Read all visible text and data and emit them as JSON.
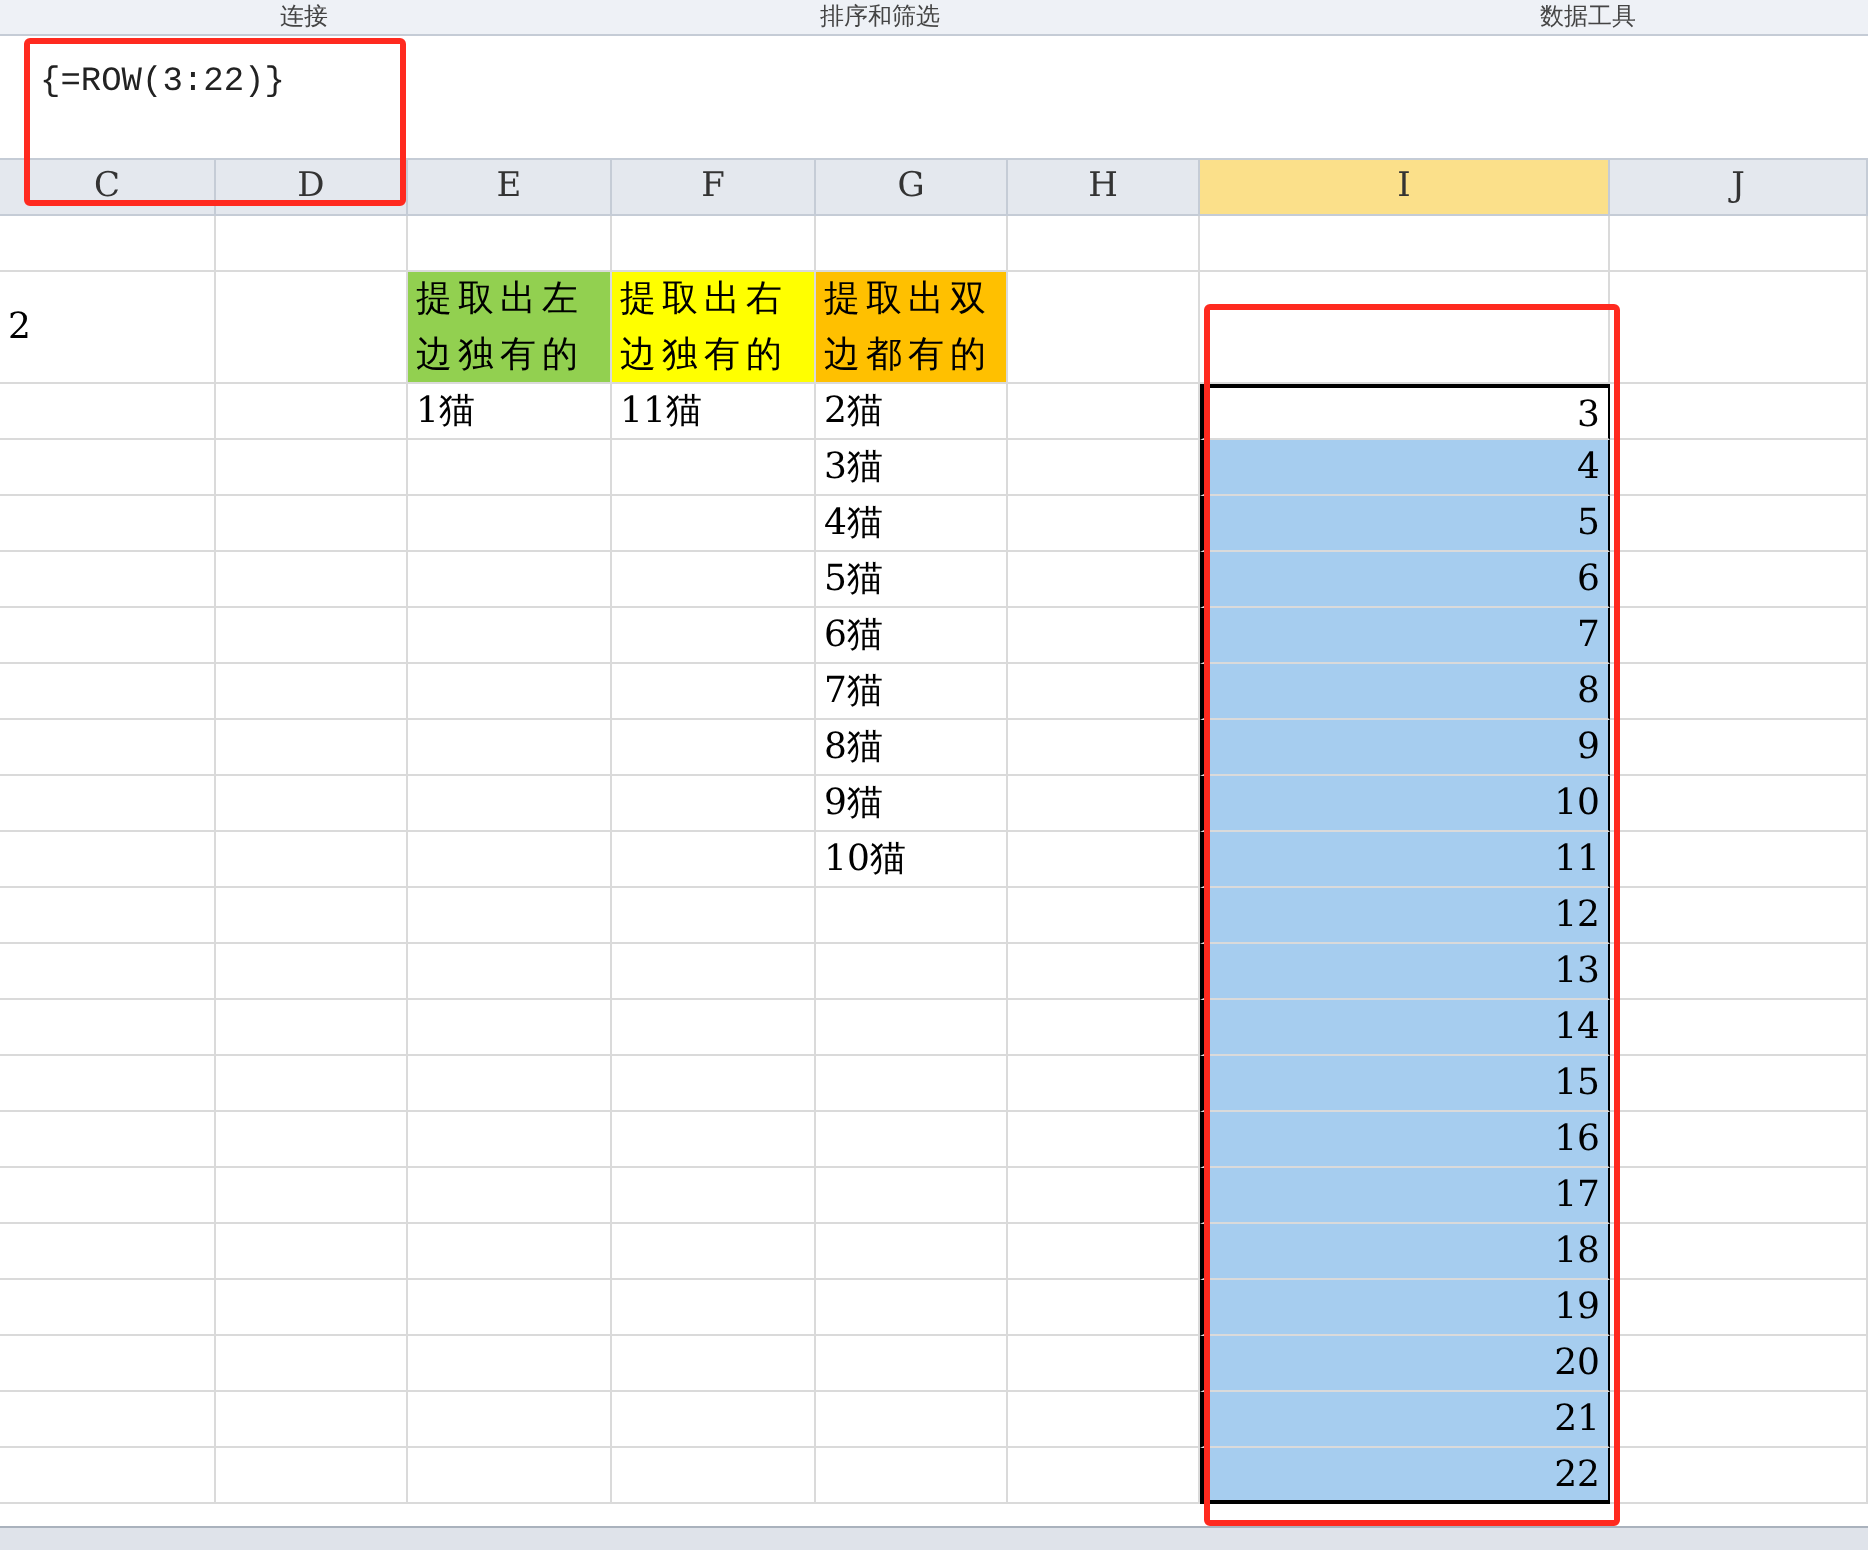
{
  "ribbon_groups": [
    "连接",
    "排序和筛选",
    "数据工具"
  ],
  "formula_bar": {
    "formula": "{=ROW(3:22)}"
  },
  "columns": [
    {
      "label": "C",
      "selected": false
    },
    {
      "label": "D",
      "selected": false
    },
    {
      "label": "E",
      "selected": false
    },
    {
      "label": "F",
      "selected": false
    },
    {
      "label": "G",
      "selected": false
    },
    {
      "label": "H",
      "selected": false
    },
    {
      "label": "I",
      "selected": true
    },
    {
      "label": "J",
      "selected": false
    }
  ],
  "rows": [
    {
      "cells": {}
    },
    {
      "cells": {
        "C": {
          "text": "2",
          "selected": false
        },
        "E": {
          "text": "提取出左边独有的",
          "color": "#92d050",
          "selected": false
        },
        "F": {
          "text": "提取出右边独有的",
          "color": "#ffff00",
          "selected": false
        },
        "G": {
          "text": "提取出双边都有的",
          "color": "#ffc000",
          "selected": false
        }
      }
    },
    {
      "cells": {
        "E": {
          "text": "1猫",
          "selected": false
        },
        "F": {
          "text": "11猫",
          "selected": false
        },
        "G": {
          "text": "2猫",
          "selected": false
        },
        "I": {
          "text": "3",
          "selected": true,
          "active": true
        }
      }
    },
    {
      "cells": {
        "G": {
          "text": "3猫",
          "selected": false
        },
        "I": {
          "text": "4",
          "selected": true,
          "active": false
        }
      }
    },
    {
      "cells": {
        "G": {
          "text": "4猫",
          "selected": false
        },
        "I": {
          "text": "5",
          "selected": true,
          "active": false
        }
      }
    },
    {
      "cells": {
        "G": {
          "text": "5猫",
          "selected": false
        },
        "I": {
          "text": "6",
          "selected": true,
          "active": false
        }
      }
    },
    {
      "cells": {
        "G": {
          "text": "6猫",
          "selected": false
        },
        "I": {
          "text": "7",
          "selected": true,
          "active": false
        }
      }
    },
    {
      "cells": {
        "G": {
          "text": "7猫",
          "selected": false
        },
        "I": {
          "text": "8",
          "selected": true,
          "active": false
        }
      }
    },
    {
      "cells": {
        "G": {
          "text": "8猫",
          "selected": false
        },
        "I": {
          "text": "9",
          "selected": true,
          "active": false
        }
      }
    },
    {
      "cells": {
        "G": {
          "text": "9猫",
          "selected": false
        },
        "I": {
          "text": "10",
          "selected": true,
          "active": false
        }
      }
    },
    {
      "cells": {
        "G": {
          "text": "10猫",
          "selected": false
        },
        "I": {
          "text": "11",
          "selected": true,
          "active": false
        }
      }
    },
    {
      "cells": {
        "I": {
          "text": "12",
          "selected": true,
          "active": false
        }
      }
    },
    {
      "cells": {
        "I": {
          "text": "13",
          "selected": true,
          "active": false
        }
      }
    },
    {
      "cells": {
        "I": {
          "text": "14",
          "selected": true,
          "active": false
        }
      }
    },
    {
      "cells": {
        "I": {
          "text": "15",
          "selected": true,
          "active": false
        }
      }
    },
    {
      "cells": {
        "I": {
          "text": "16",
          "selected": true,
          "active": false
        }
      }
    },
    {
      "cells": {
        "I": {
          "text": "17",
          "selected": true,
          "active": false
        }
      }
    },
    {
      "cells": {
        "I": {
          "text": "18",
          "selected": true,
          "active": false
        }
      }
    },
    {
      "cells": {
        "I": {
          "text": "19",
          "selected": true,
          "active": false
        }
      }
    },
    {
      "cells": {
        "I": {
          "text": "20",
          "selected": true,
          "active": false
        }
      }
    },
    {
      "cells": {
        "I": {
          "text": "21",
          "selected": true,
          "active": false
        }
      }
    },
    {
      "cells": {
        "I": {
          "text": "22",
          "selected": true,
          "active": false
        }
      }
    }
  ]
}
